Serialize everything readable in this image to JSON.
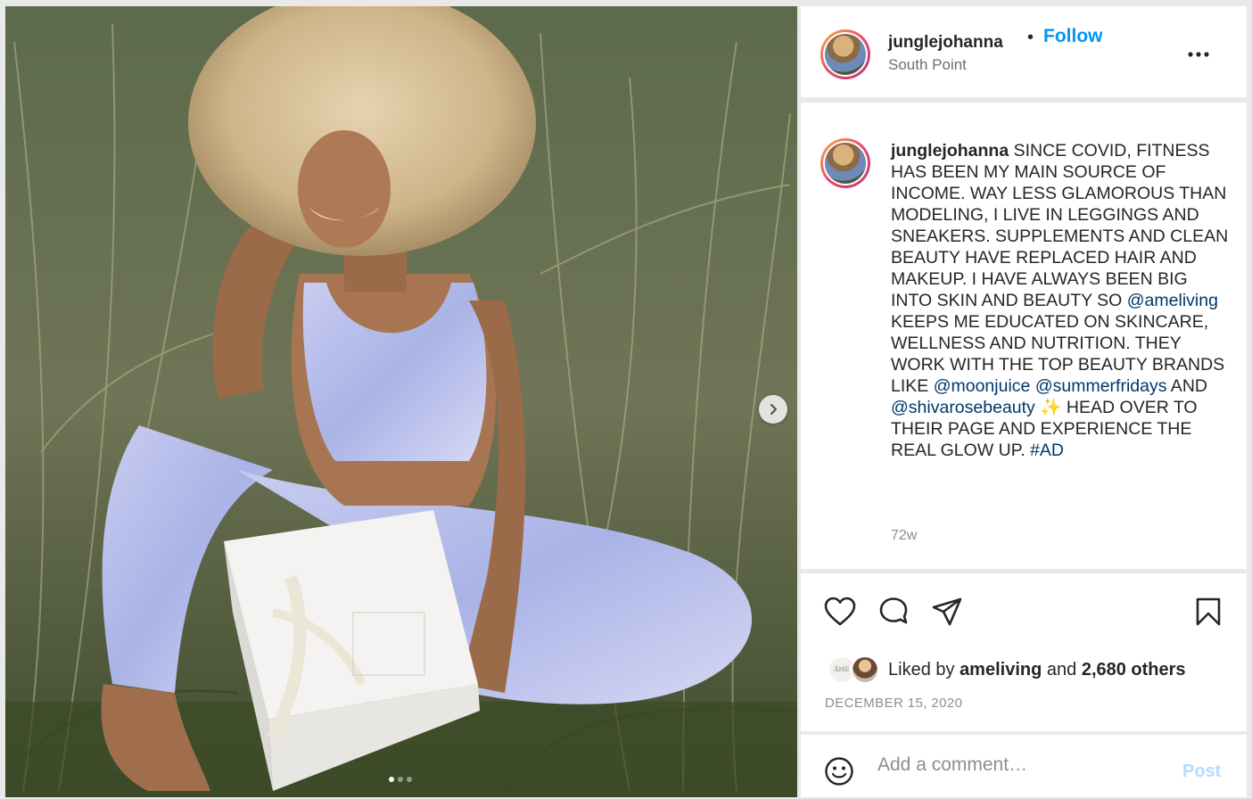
{
  "post": {
    "username": "junglejohanna",
    "follow_label": "Follow",
    "bullet": "•",
    "location": "South Point",
    "more_label": "...",
    "photo_dots": 3,
    "photo_active_index": 0
  },
  "caption": {
    "parts": [
      {
        "type": "text",
        "text": " SINCE COVID, FITNESS HAS BEEN MY MAIN SOURCE OF INCOME. WAY LESS GLAMOROUS THAN MODELING, I LIVE IN LEGGINGS AND SNEAKERS. SUPPLEMENTS AND CLEAN BEAUTY HAVE REPLACED HAIR AND MAKEUP. I HAVE ALWAYS BEEN BIG INTO SKIN AND BEAUTY SO "
      },
      {
        "type": "mention",
        "text": "@ameliving"
      },
      {
        "type": "text",
        "text": " KEEPS ME EDUCATED ON SKINCARE, WELLNESS AND NUTRITION. THEY WORK WITH THE TOP BEAUTY BRANDS LIKE "
      },
      {
        "type": "mention",
        "text": "@moonjuice"
      },
      {
        "type": "text",
        "text": " "
      },
      {
        "type": "mention",
        "text": "@summerfridays"
      },
      {
        "type": "text",
        "text": " AND "
      },
      {
        "type": "mention",
        "text": "@shivarosebeauty"
      },
      {
        "type": "text",
        "text": " ✨ HEAD OVER TO THEIR PAGE AND EXPERIENCE THE REAL GLOW UP. "
      },
      {
        "type": "mention",
        "text": "#AD"
      }
    ],
    "time_ago": "72w"
  },
  "likes": {
    "prefix": "Liked by",
    "first_liker": "ameliving",
    "connector": "and",
    "others": "2,680 others",
    "mini_avatar_text": "ÂME"
  },
  "date": "DECEMBER 15, 2020",
  "comment": {
    "placeholder": "Add a comment…",
    "post_label": "Post"
  },
  "colors": {
    "link_blue": "#0095f6",
    "mention_blue": "#00376b",
    "post_disabled": "#b3dbff",
    "muted": "#8e8e8e"
  },
  "icons": [
    "heart-icon",
    "comment-icon",
    "share-icon",
    "bookmark-icon",
    "smiley-icon",
    "chevron-right-icon"
  ]
}
